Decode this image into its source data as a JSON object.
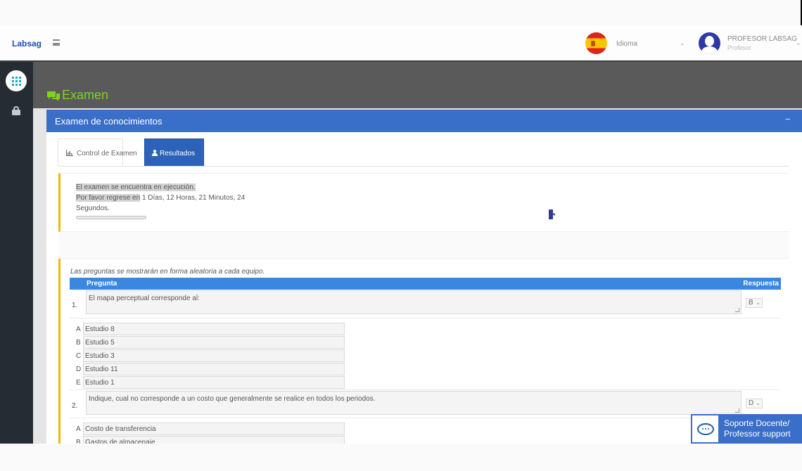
{
  "brand": "Labsag",
  "header": {
    "language_label": "Idioma",
    "user_name": "PROFESOR LABSAG",
    "user_role": "Profesor"
  },
  "page": {
    "title": "Examen",
    "panel_title": "Examen de conocimientos",
    "collapse_label": "−"
  },
  "tabs": [
    {
      "label": "Control de Examen",
      "active": false,
      "icon": "bar-chart-icon"
    },
    {
      "label": "Resultados",
      "active": true,
      "icon": "user-icon"
    }
  ],
  "notice": {
    "line1": "El examen se encuentra en ejecución.",
    "line2_prefix": "Por favor regrese en",
    "line2_rest": " 1 Días, 12 Horas, 21 Minutos, 24",
    "line3": "Segundos.",
    "progress": 0
  },
  "questions_intro": "Las preguntas se mostrarán en forma aleatoria a cada equipo.",
  "table_headers": {
    "question": "Pregunta",
    "answer": "Respuesta"
  },
  "questions": [
    {
      "number": "1.",
      "text": "El mapa perceptual corresponde al:",
      "answer": "B",
      "options": [
        {
          "letter": "A",
          "text": "Estudio 8"
        },
        {
          "letter": "B",
          "text": "Estudio 5"
        },
        {
          "letter": "C",
          "text": "Estudio 3"
        },
        {
          "letter": "D",
          "text": "Estudio 11"
        },
        {
          "letter": "E",
          "text": "Estudio 1"
        }
      ]
    },
    {
      "number": "2.",
      "text": "Indique, cual no corresponde a un costo que generalmente se realice en todos los periodos.",
      "answer": "D",
      "options": [
        {
          "letter": "A",
          "text": "Costo de transferencia"
        },
        {
          "letter": "B",
          "text": "Gastos de almacenaje"
        }
      ]
    }
  ],
  "support": {
    "line1": "Soporte Docente/",
    "line2": "Professor support"
  },
  "colors": {
    "brand": "#1d4bb5",
    "panel_header": "#3a6fc9",
    "table_header": "#3a87e0",
    "title_green": "#7ed321",
    "accent_yellow": "#f2b705",
    "sidebar": "#262c33"
  }
}
